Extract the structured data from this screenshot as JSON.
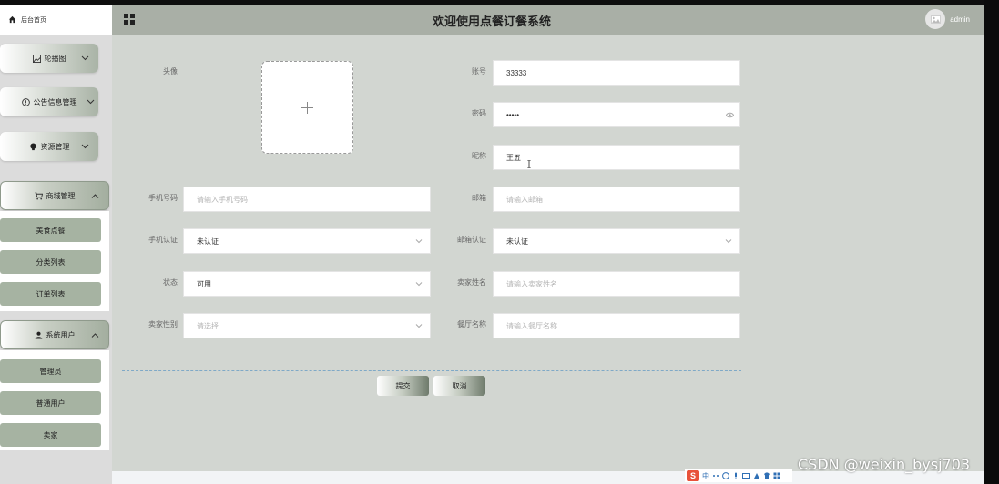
{
  "header": {
    "home_label": "后台首页",
    "title": "欢迎使用点餐订餐系统",
    "username": "admin"
  },
  "sidebar": {
    "menus": [
      {
        "label": "轮播图",
        "icon": "picture-icon",
        "open": false
      },
      {
        "label": "公告信息管理",
        "icon": "info-circle-icon",
        "open": false
      },
      {
        "label": "资源管理",
        "icon": "bulb-icon",
        "open": false
      },
      {
        "label": "商城管理",
        "icon": "cart-icon",
        "open": true
      },
      {
        "label": "系统用户",
        "icon": "user-icon",
        "open": true
      }
    ],
    "mall_items": [
      "美食点餐",
      "分类列表",
      "订单列表"
    ],
    "user_items": [
      "管理员",
      "普通用户",
      "卖家"
    ]
  },
  "form": {
    "avatar_label": "头像",
    "account_label": "账号",
    "account_value": "33333",
    "password_label": "密码",
    "password_value": "•••••",
    "nickname_label": "昵称",
    "nickname_value": "王五",
    "phone_label": "手机号码",
    "phone_placeholder": "请输入手机号码",
    "email_label": "邮箱",
    "email_placeholder": "请输入邮箱",
    "phone_verify_label": "手机认证",
    "phone_verify_value": "未认证",
    "email_verify_label": "邮箱认证",
    "email_verify_value": "未认证",
    "status_label": "状态",
    "status_value": "可用",
    "seller_name_label": "卖家姓名",
    "seller_name_placeholder": "请输入卖家姓名",
    "seller_gender_label": "卖家性别",
    "seller_gender_placeholder": "请选择",
    "restaurant_label": "餐厅名称",
    "restaurant_placeholder": "请输入餐厅名称",
    "submit_label": "提交",
    "cancel_label": "取消"
  },
  "tray": {
    "ime_logo": "S",
    "ime_lang": "中"
  },
  "watermark": "CSDN @weixin_bysj703",
  "colors": {
    "header_bg": "#a9afa6",
    "main_bg": "#d2d6d1",
    "sidebar_bg": "#dcdcdc",
    "sub_item_bg": "#a6b3a2"
  }
}
